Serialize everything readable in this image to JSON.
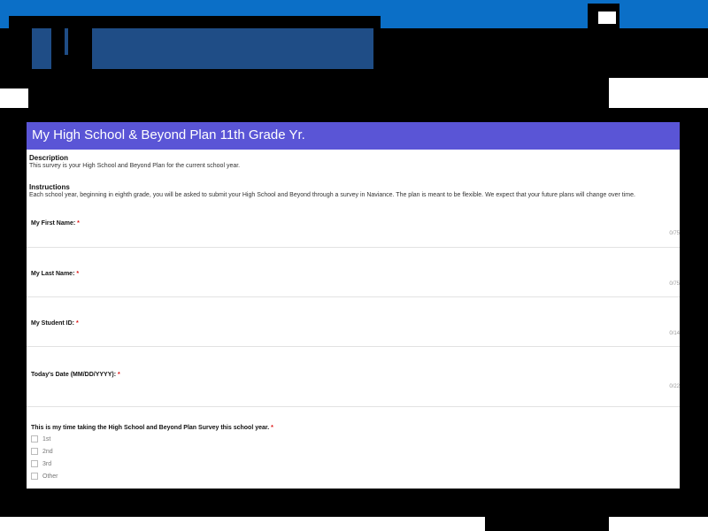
{
  "form": {
    "title": "My High School & Beyond Plan 11th Grade Yr.",
    "description_heading": "Description",
    "description_text": "This survey is your High School and Beyond Plan for the current school year.",
    "instructions_heading": "Instructions",
    "instructions_text": "Each school year, beginning in eighth grade, you will be asked to submit your High School and Beyond through a survey in Naviance. The plan is meant to be flexible. We expect that your future plans will change over time.",
    "fields": [
      {
        "label": "My First Name:",
        "required": "*",
        "counter": "0/75"
      },
      {
        "label": "My Last Name:",
        "required": "*",
        "counter": "0/75"
      },
      {
        "label": "My Student ID:",
        "required": "*",
        "counter": "0/14"
      },
      {
        "label": "Today's Date (MM/DD/YYYY):",
        "required": "*",
        "counter": "0/22"
      }
    ],
    "question": {
      "label": "This is my      time taking the High School and Beyond Plan Survey this school year.",
      "required": "*",
      "options": [
        "1st",
        "2nd",
        "3rd",
        "Other"
      ]
    }
  }
}
